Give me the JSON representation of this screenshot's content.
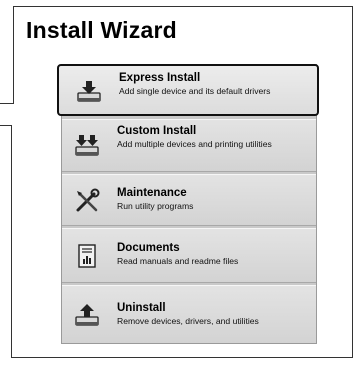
{
  "wizard": {
    "title": "Install Wizard",
    "items": [
      {
        "label": "Express Install",
        "description": "Add single device and its default drivers",
        "icon": "install-tray-icon",
        "selected": true
      },
      {
        "label": "Custom Install",
        "description": "Add multiple devices and printing utilities",
        "icon": "custom-install-icon",
        "selected": false
      },
      {
        "label": "Maintenance",
        "description": "Run utility programs",
        "icon": "tools-icon",
        "selected": false
      },
      {
        "label": "Documents",
        "description": "Read manuals and readme files",
        "icon": "document-icon",
        "selected": false
      },
      {
        "label": "Uninstall",
        "description": "Remove devices, drivers, and utilities",
        "icon": "uninstall-tray-icon",
        "selected": false
      }
    ]
  },
  "colors": {
    "panel_background": "#c9c9c9",
    "item_background": "#d9d9d9",
    "selected_border": "#111111",
    "icon_dark": "#222222"
  }
}
